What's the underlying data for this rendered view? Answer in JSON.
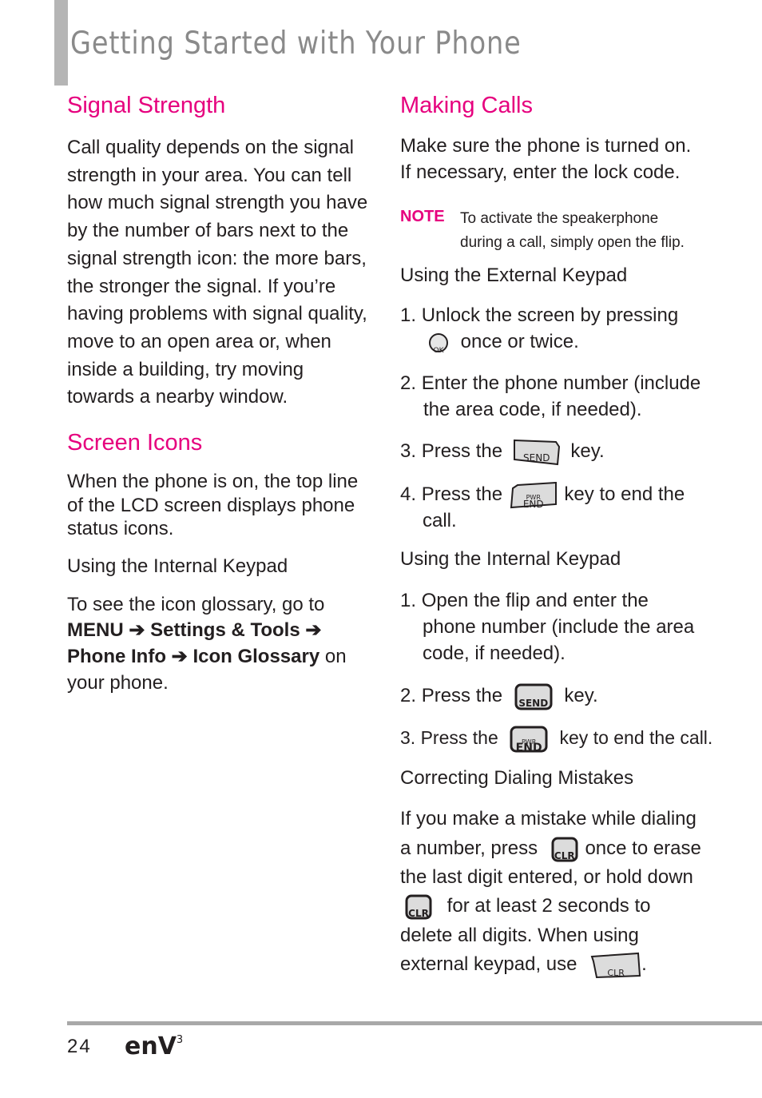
{
  "header": {
    "title": "Getting Started with Your Phone"
  },
  "left": {
    "signal": {
      "heading": "Signal Strength",
      "lines": [
        "Call quality depends on the signal",
        "strength in your area. You can tell",
        "how much signal strength you have",
        "by the number of bars next to the",
        "signal strength icon: the more bars,",
        "the stronger the signal. If you’re",
        "having problems with signal quality,",
        "move to an open area or, when",
        "inside a building, try moving",
        "towards a nearby window."
      ]
    },
    "icons": {
      "heading": "Screen Icons",
      "lines": [
        "When the phone is on, the top line",
        "of the LCD screen displays phone",
        "status icons."
      ],
      "subheading": "Using the Internal Keypad",
      "glossary_intro": "To see the icon glossary, go to",
      "path": [
        "MENU",
        "Settings & Tools",
        "Phone Info",
        "Icon Glossary"
      ],
      "arrow": "➔",
      "suffix": "on",
      "suffix_line": "your phone."
    }
  },
  "right": {
    "heading": "Making Calls",
    "intro": [
      "Make sure the phone is turned on.",
      "If necessary, enter the lock code."
    ],
    "note": {
      "label": "NOTE",
      "lines": [
        "To activate the speakerphone",
        "during a call, simply open the flip."
      ]
    },
    "external": {
      "heading": "Using the External Keypad",
      "steps": [
        {
          "num": "1.",
          "a": "Unlock the screen by pressing",
          "b": "once or twice."
        },
        {
          "num": "2.",
          "a": "Enter the phone number (include",
          "b": "the area code, if needed)."
        },
        {
          "num": "3.",
          "a": "Press the",
          "b": "key."
        },
        {
          "num": "4.",
          "a": "Press the",
          "b": "key to end the",
          "c": "call."
        }
      ]
    },
    "internal": {
      "heading": "Using the Internal Keypad",
      "steps": [
        {
          "num": "1.",
          "lines": [
            "Open the flip and enter the",
            "phone number (include the area",
            "code, if needed)."
          ]
        },
        {
          "num": "2.",
          "a": "Press the",
          "b": "key."
        },
        {
          "num": "3.",
          "a": "Press the",
          "b": "key to end the call."
        }
      ]
    },
    "correct": {
      "heading": "Correcting Dialing Mistakes",
      "l1": "If you make a mistake while dialing",
      "l2a": "a number, press",
      "l2b": "once to erase",
      "l3": "the last digit entered, or hold down",
      "l4": "for at least 2 seconds to",
      "l5": "delete all digits. When using",
      "l6": "external keypad, use",
      "l6end": "."
    },
    "keys": {
      "ok": "OK",
      "send": "SEND",
      "pwr": "PWR",
      "end": "END",
      "clr": "CLR"
    }
  },
  "footer": {
    "page_number": "24",
    "logo": "enV",
    "logo_sup": "3"
  }
}
